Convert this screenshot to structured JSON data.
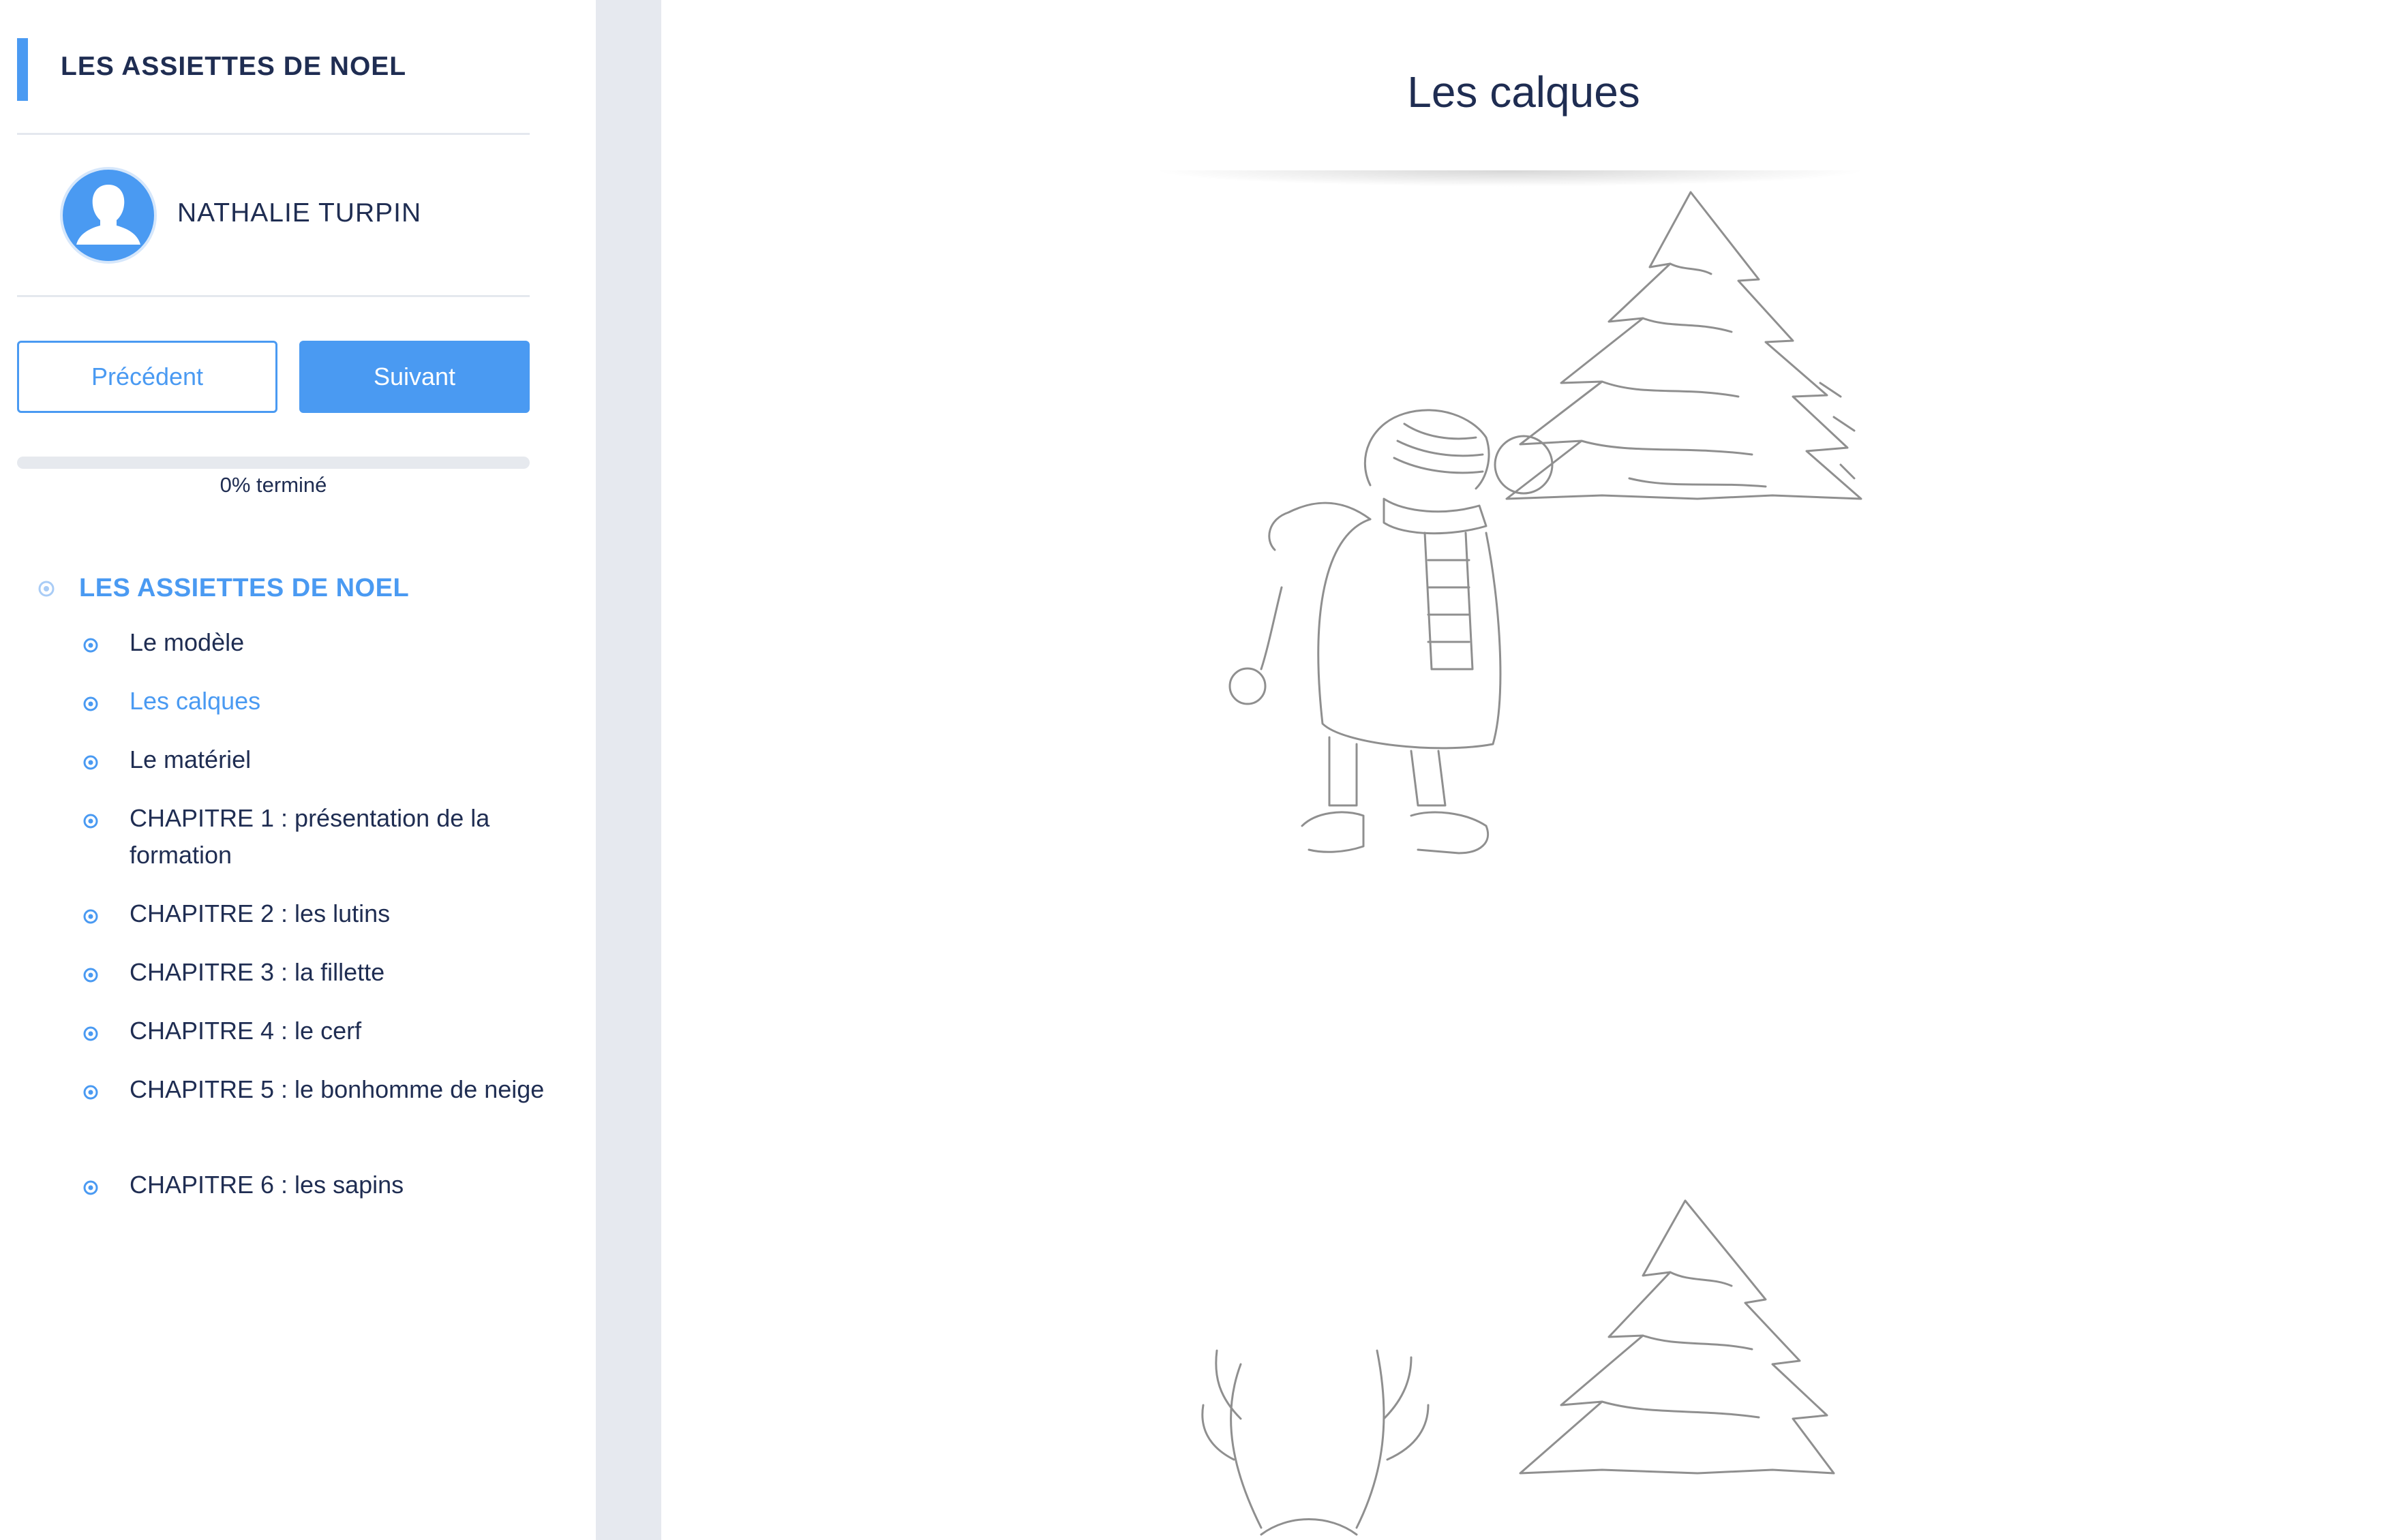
{
  "course": {
    "title": "LES ASSIETTES DE NOEL"
  },
  "user": {
    "name": "NATHALIE TURPIN",
    "avatar_icon": "user-silhouette-icon"
  },
  "buttons": {
    "previous": "Précédent",
    "next": "Suivant"
  },
  "progress": {
    "percent": 0,
    "label": "0% terminé"
  },
  "nav": {
    "section": "LES ASSIETTES DE NOEL",
    "items": [
      {
        "label": "Le modèle",
        "active": false
      },
      {
        "label": "Les calques",
        "active": true
      },
      {
        "label": "Le matériel",
        "active": false
      },
      {
        "label": "CHAPITRE 1 : présentation de la formation",
        "active": false
      },
      {
        "label": "CHAPITRE 2 : les lutins",
        "active": false
      },
      {
        "label": "CHAPITRE 3 : la fillette",
        "active": false
      },
      {
        "label": "CHAPITRE 4 : le cerf",
        "active": false
      },
      {
        "label": "CHAPITRE 5 : le bonhomme de neige",
        "active": false
      },
      {
        "label": "CHAPITRE 6 : les sapins",
        "active": false
      }
    ]
  },
  "main": {
    "title": "Les calques",
    "image_icon": "pencil-sketch-image"
  },
  "colors": {
    "accent": "#4a9af2",
    "text": "#1f2d52",
    "gutter": "#e6e9ef"
  }
}
